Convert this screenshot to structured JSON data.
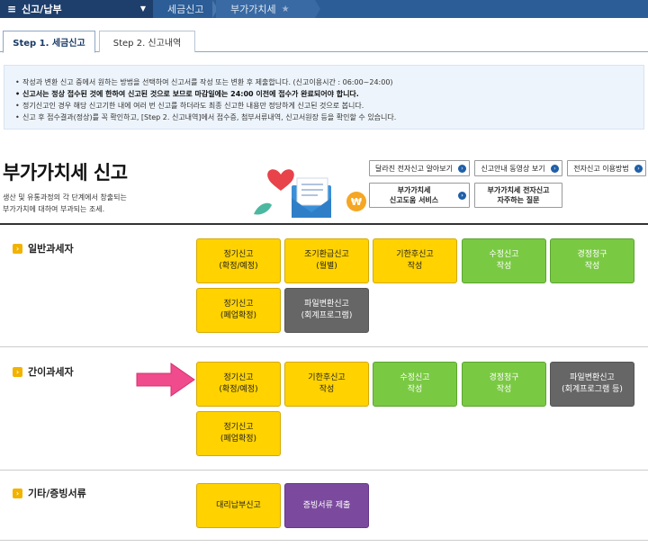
{
  "topbar": {
    "menu_label": "신고/납부",
    "breadcrumbs": [
      "세금신고",
      "부가가치세"
    ]
  },
  "tabs": [
    {
      "label": "Step 1. 세금신고",
      "active": true
    },
    {
      "label": "Step 2. 신고내역",
      "active": false
    }
  ],
  "notice": {
    "lines": [
      "작성과 변환 신고 중에서 원하는 방법을 선택하여 신고서를 작성 또는 변환 후 제출합니다. (신고이용시간 : 06:00~24:00)",
      "신고서는 정상 접수된 것에 한하여 신고된 것으로 보므로 마감일에는 24:00 이전에 접수가 완료되어야 합니다.",
      "정기신고인 경우 해당 신고기한 내에 여러 번 신고를 하더라도 최종 신고한 내용만 정당하게 신고된 것으로 봅니다.",
      "신고 후 접수결과(정상)를 꼭 확인하고, [Step 2. 신고내역]에서 접수증, 첨부서류내역, 신고서원장 등을 확인할 수 있습니다."
    ]
  },
  "page": {
    "title": "부가가치세 신고",
    "desc1": "생산 및 유통과정의 각 단계에서 창출되는",
    "desc2": "부가가치에 대하여 부과되는 조세."
  },
  "quick_links": {
    "q1": "달라진 전자신고 알아보기",
    "q2": "신고안내 동영상 보기",
    "q3": "전자신고 이용방법",
    "q4": "부가가치세\n신고도움 서비스",
    "q5": "부가가치세 전자신고\n자주하는 질문"
  },
  "sections": {
    "general": {
      "label": "일반과세자",
      "b1": "정기신고\n(확정/예정)",
      "b2": "조기환급신고\n(월별)",
      "b3": "기한후신고\n작성",
      "b4": "수정신고\n작성",
      "b5": "경정청구\n작성",
      "b6": "정기신고\n(폐업확정)",
      "b7": "파일변환신고\n(회계프로그램)"
    },
    "simple": {
      "label": "간이과세자",
      "b1": "정기신고\n(확정/예정)",
      "b2": "기한후신고\n작성",
      "b3": "수정신고\n작성",
      "b4": "경정청구\n작성",
      "b5": "파일변환신고\n(회계프로그램 등)",
      "b6": "정기신고\n(폐업확정)"
    },
    "etc": {
      "label": "기타/증빙서류",
      "b1": "대리납부신고",
      "b2": "증빙서류 제출"
    }
  },
  "colors": {
    "nav": "#2c5d96",
    "yellow": "#ffd200",
    "green": "#7ac943",
    "gray": "#666666",
    "purple": "#7b4a9e",
    "arrow": "#f04b8c"
  }
}
